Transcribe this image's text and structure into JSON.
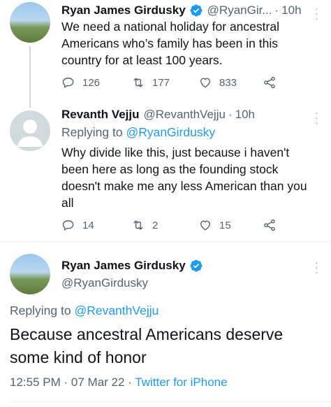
{
  "tweet1": {
    "name": "Ryan James Girdusky",
    "handle": "@RyanGir...",
    "dot": "·",
    "time": "10h",
    "text": "We need a national holiday for ancestral Americans who’s family has been in this country for at least 100 years.",
    "replies": "126",
    "retweets": "177",
    "likes": "833"
  },
  "tweet2": {
    "name": "Revanth Vejju",
    "handle": "@RevanthVejju",
    "dot": "·",
    "time": "10h",
    "replying_prefix": "Replying to",
    "replying_handle": "@RyanGirdusky",
    "text": "Why divide like this, just because i haven't been here as long as the founding stock doesn't make me any less American than you all",
    "replies": "14",
    "retweets": "2",
    "likes": "15"
  },
  "tweet3": {
    "name": "Ryan James Girdusky",
    "handle": "@RyanGirdusky",
    "replying_prefix": "Replying to",
    "replying_handle": "@RevanthVejju",
    "text": "Because ancestral Americans deserve some kind of honor",
    "time": "12:55 PM",
    "date": "07 Mar 22",
    "sep": "·",
    "source": "Twitter for iPhone"
  },
  "icons": {
    "verified": "verified-badge-icon",
    "reply": "reply-icon",
    "retweet": "retweet-icon",
    "like": "heart-icon",
    "share": "share-icon",
    "more": "more-vertical-icon"
  },
  "colors": {
    "link": "#1d9bf0",
    "secondary": "#536471",
    "text": "#0f1419"
  }
}
